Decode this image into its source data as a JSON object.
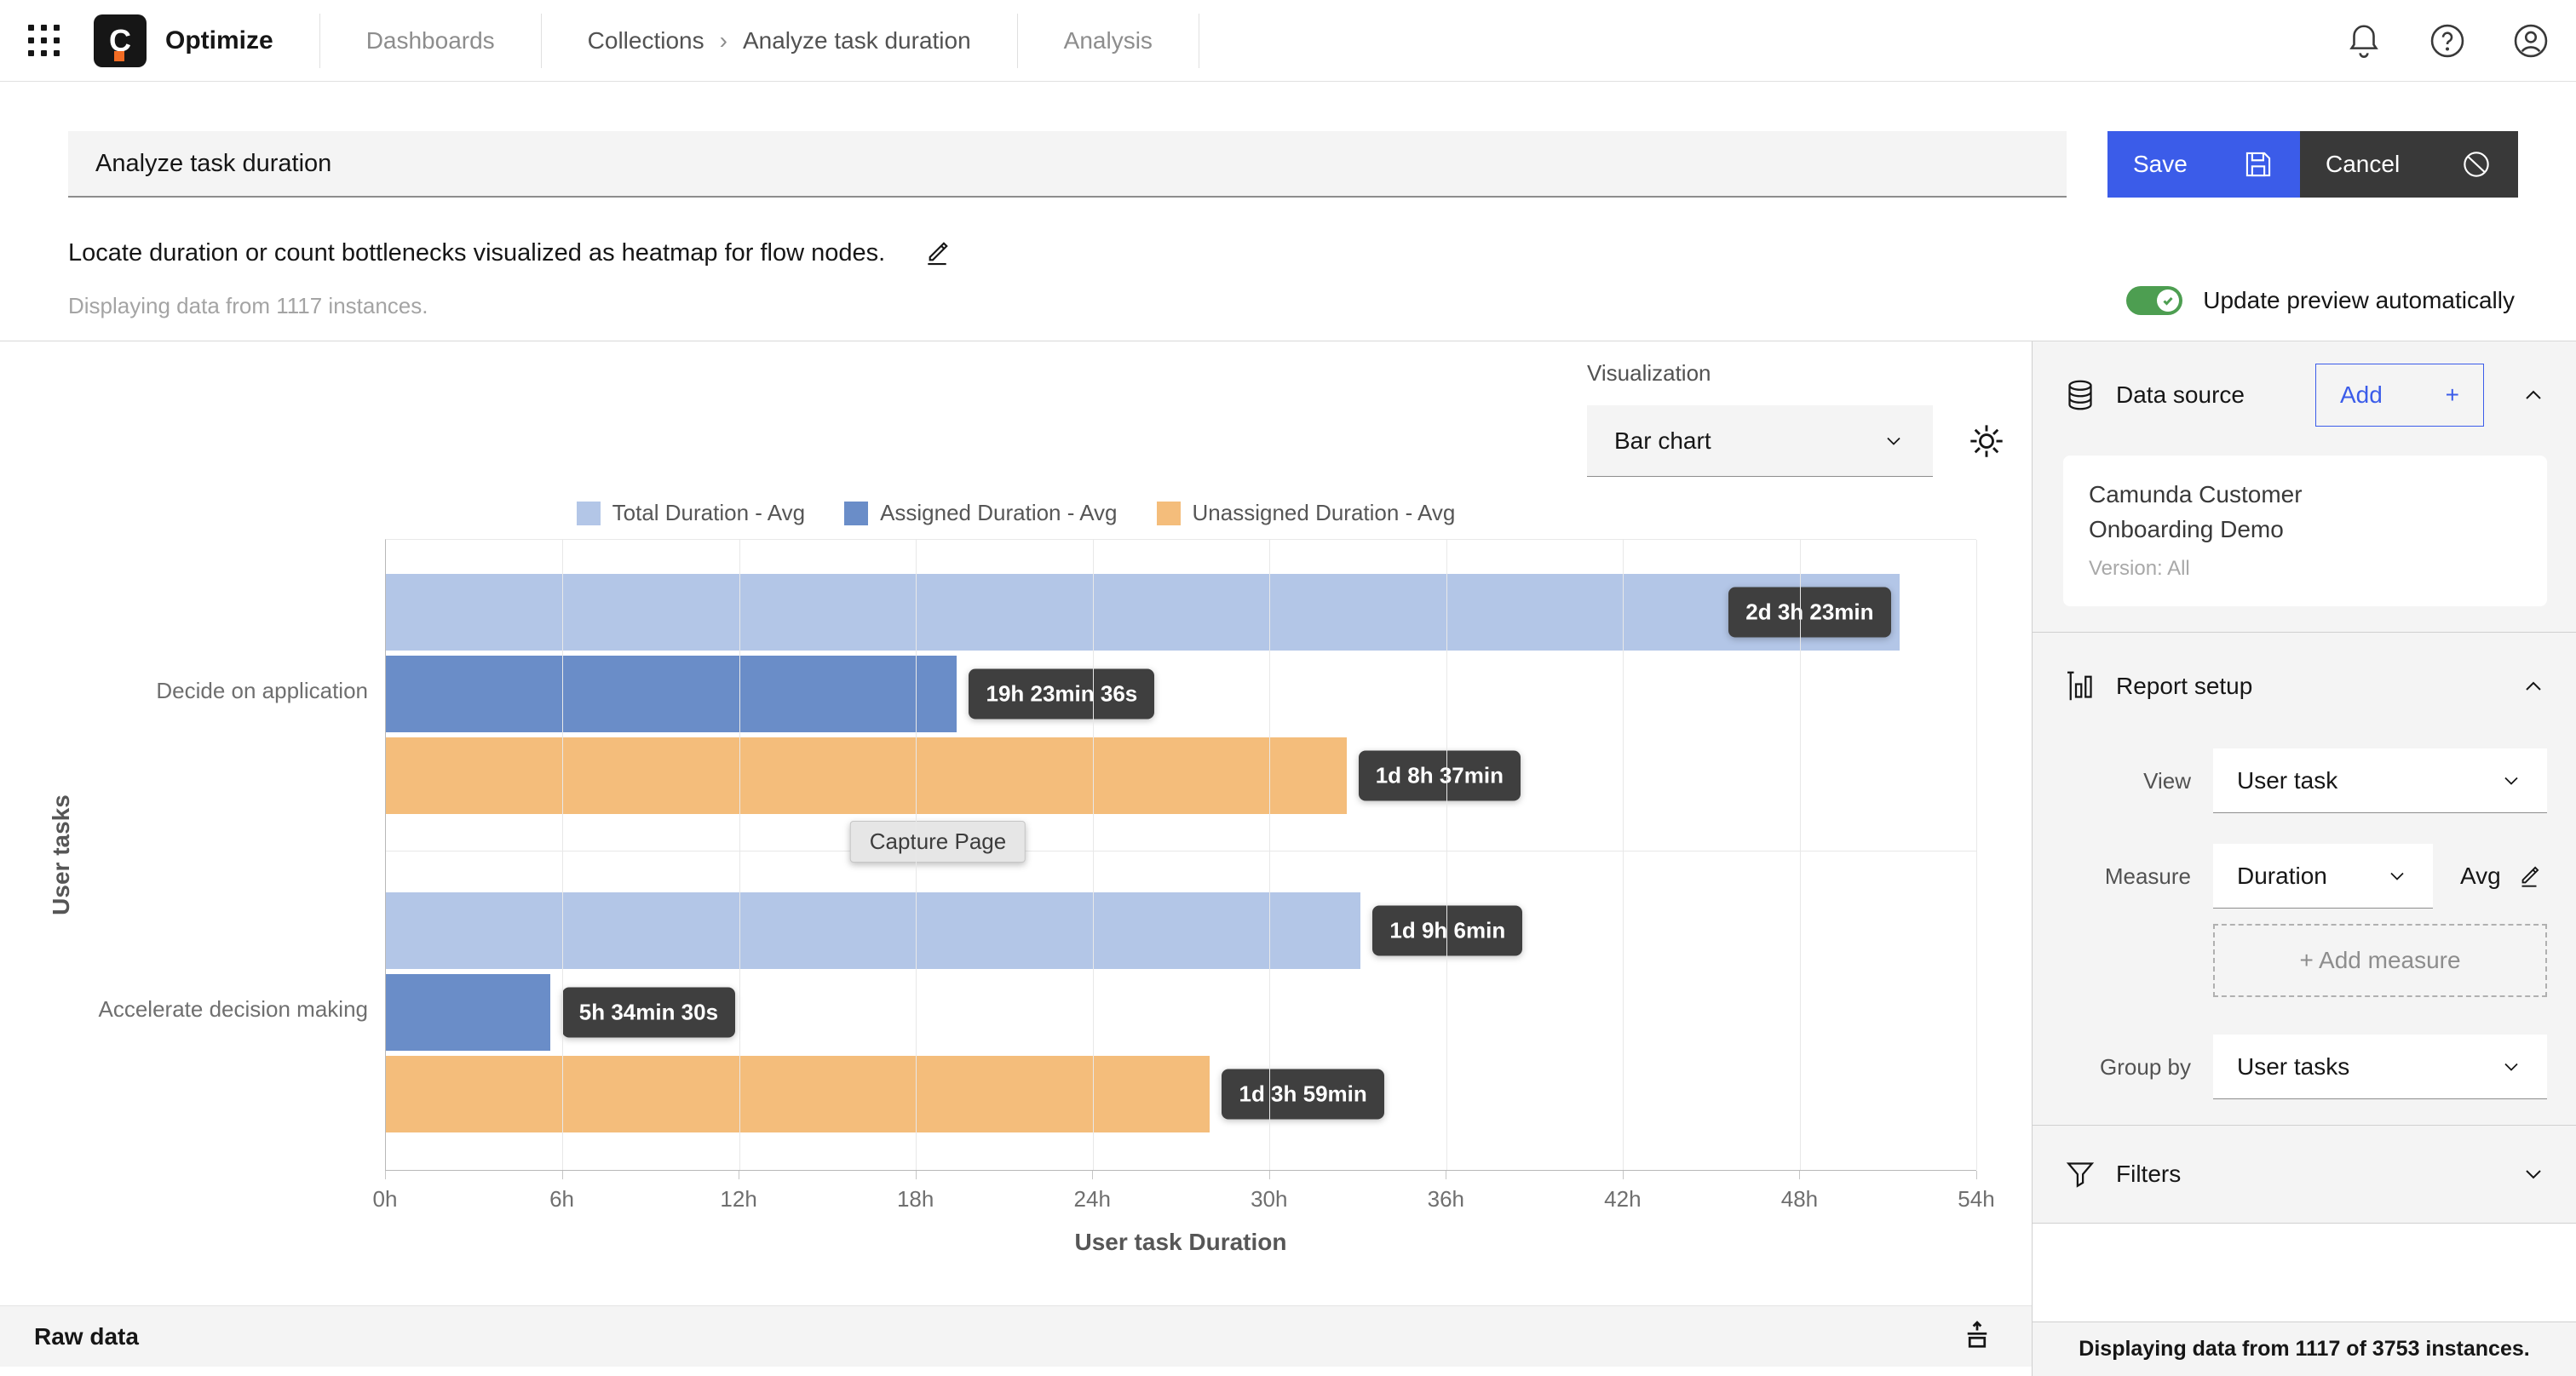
{
  "nav": {
    "product": "Optimize",
    "logo_letter": "C",
    "items": [
      {
        "label": "Dashboards"
      },
      {
        "label": "Collections"
      },
      {
        "label": "Analyze task duration"
      },
      {
        "label": "Analysis"
      }
    ],
    "breadcrumb_separator": "›"
  },
  "header": {
    "title_value": "Analyze task duration",
    "save_label": "Save",
    "cancel_label": "Cancel",
    "description": "Locate duration or count bottlenecks visualized as heatmap for flow nodes.",
    "instances_note": "Displaying data from 1117 instances.",
    "auto_preview_label": "Update preview automatically"
  },
  "visualization": {
    "label": "Visualization",
    "selected": "Bar chart"
  },
  "chart_data": {
    "type": "bar",
    "orientation": "horizontal",
    "xlabel": "User task Duration",
    "ylabel": "User tasks",
    "x_ticks": [
      "0h",
      "6h",
      "12h",
      "18h",
      "24h",
      "30h",
      "36h",
      "42h",
      "48h",
      "54h"
    ],
    "xlim_hours": [
      0,
      54
    ],
    "grid": true,
    "legend_position": "top",
    "categories": [
      "Decide on application",
      "Accelerate decision making"
    ],
    "series": [
      {
        "name": "Total Duration - Avg",
        "color": "#b3c6e7",
        "values_hours": [
          51.383,
          33.1
        ],
        "labels": [
          "2d 3h 23min",
          "1d 9h 6min"
        ]
      },
      {
        "name": "Assigned Duration - Avg",
        "color": "#6a8dc8",
        "values_hours": [
          19.393,
          5.575
        ],
        "labels": [
          "19h 23min 36s",
          "5h 34min 30s"
        ]
      },
      {
        "name": "Unassigned Duration - Avg",
        "color": "#f4bd7b",
        "values_hours": [
          32.617,
          27.983
        ],
        "labels": [
          "1d 8h 37min",
          "1d 3h 59min"
        ]
      }
    ],
    "overlay_tooltip": "Capture Page"
  },
  "sidebar": {
    "data_source": {
      "title": "Data source",
      "add_label": "Add",
      "add_plus": "+",
      "card": {
        "name": "Camunda Customer Onboarding Demo",
        "version": "Version: All"
      }
    },
    "report_setup": {
      "title": "Report setup",
      "view_label": "View",
      "view_value": "User task",
      "measure_label": "Measure",
      "measure_value": "Duration",
      "aggregation": "Avg",
      "add_measure_label": "+ Add measure",
      "group_by_label": "Group by",
      "group_by_value": "User tasks"
    },
    "filters": {
      "title": "Filters"
    },
    "footer_note": "Displaying data from 1117 of 3753 instances."
  },
  "raw_data": {
    "label": "Raw data"
  },
  "colors": {
    "accent_blue": "#3b5ce9",
    "cancel_dark": "#393939",
    "toggle_green": "#4d9e51",
    "bar_light_blue": "#b3c6e7",
    "bar_blue": "#6a8dc8",
    "bar_orange": "#f4bd7b",
    "value_chip_dark": "#3f3f3f"
  }
}
